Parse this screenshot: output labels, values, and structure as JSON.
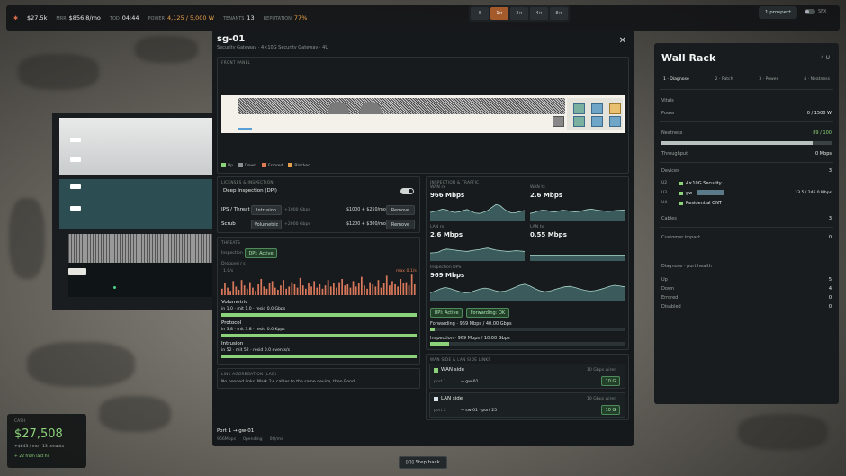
{
  "hud": {
    "status_icon": "bug-icon",
    "items": [
      {
        "label": "",
        "value": "$27.5k",
        "tone": "normal"
      },
      {
        "label": "MRR",
        "value": "$856.8/mo",
        "tone": "normal"
      },
      {
        "label": "TOD",
        "value": "04:44",
        "tone": "normal"
      },
      {
        "label": "POWER",
        "value": "4,125 / 5,000 W",
        "tone": "warn"
      },
      {
        "label": "TENANTS",
        "value": "13",
        "tone": "normal"
      },
      {
        "label": "REPUTATION",
        "value": "77%",
        "tone": "warn"
      }
    ],
    "speed_buttons": [
      "II",
      "1×",
      "2×",
      "4×",
      "8×"
    ],
    "speed_active": 1,
    "prospect_label": "1 prospect",
    "sfx_label": "SFX"
  },
  "modal": {
    "title": "sg-01",
    "subtitle": "Security Gateway · 4×10G Security Gateway · 4U",
    "close_icon": "close-icon",
    "front_panel": {
      "header": "FRONT PANEL",
      "legend": [
        {
          "label": "Up",
          "color": "#8cd27a"
        },
        {
          "label": "Down",
          "color": "#8a8f92"
        },
        {
          "label": "Errored",
          "color": "#e07a52"
        },
        {
          "label": "Blocked",
          "color": "#e0a050"
        }
      ]
    },
    "licenses": {
      "header": "LICENSES & INSPECTION",
      "dpi_label": "Deep Inspection (DPI)",
      "rows": [
        {
          "name": "IPS / Threat",
          "tier": "Intrusion",
          "cap": "+1000 Gbps",
          "price": "$1000 + $250/mo",
          "action": "Remove"
        },
        {
          "name": "Scrub",
          "tier": "Volumetric",
          "cap": "+2000 Gbps",
          "price": "$1200 + $300/mo",
          "action": "Remove"
        }
      ]
    },
    "threats": {
      "header": "THREATS",
      "inspection_label": "Inspection",
      "dpi_badge": "DPI: Active",
      "dropped_label": "Dropped / s",
      "scale_label": "1.0/s",
      "max_label": "max 0.1/s",
      "categories": [
        {
          "name": "Volumetric",
          "stats": "in 1.0 · mit 1.0 · resid 0.0 Gbps",
          "frac": 1.0
        },
        {
          "name": "Protocol",
          "stats": "in 3.8 · mit 3.8 · resid 0.0 Kpps",
          "frac": 1.0
        },
        {
          "name": "Intrusion",
          "stats": "in 52 · mit 52 · resid 0.0 events/s",
          "frac": 1.0
        }
      ],
      "drop_series": [
        0.3,
        0.55,
        0.35,
        0.2,
        0.65,
        0.4,
        0.25,
        0.7,
        0.45,
        0.3,
        0.6,
        0.35,
        0.2,
        0.5,
        0.75,
        0.4,
        0.3,
        0.55,
        0.65,
        0.35,
        0.25,
        0.45,
        0.7,
        0.3,
        0.4,
        0.6,
        0.5,
        0.35,
        0.8,
        0.45,
        0.3,
        0.55,
        0.4,
        0.65,
        0.35,
        0.5,
        0.3,
        0.45,
        0.7,
        0.4,
        0.55,
        0.35,
        0.6,
        0.75,
        0.45,
        0.5,
        0.35,
        0.65,
        0.4,
        0.55,
        0.85,
        0.45,
        0.3,
        0.6,
        0.5,
        0.4,
        0.7,
        0.35,
        0.55,
        0.9,
        0.45,
        0.65,
        0.5,
        0.4,
        0.75,
        0.55,
        0.6,
        0.45,
        0.95,
        0.5
      ]
    },
    "lag": {
      "header": "LINK AGGREGATION (LAG)",
      "text": "No bonded links. Mark 2+ cables to the same device, then Bond."
    },
    "inspection": {
      "header": "INSPECTION & TRAFFIC",
      "graphs": [
        {
          "label": "WAN rx",
          "value": "966 Mbps",
          "series": [
            0.45,
            0.5,
            0.55,
            0.62,
            0.58,
            0.5,
            0.45,
            0.48,
            0.55,
            0.6,
            0.5,
            0.42,
            0.4,
            0.46,
            0.55,
            0.7,
            0.85,
            0.8,
            0.62,
            0.48,
            0.42,
            0.45,
            0.5,
            0.55
          ]
        },
        {
          "label": "WAN tx",
          "value": "2.6 Mbps",
          "series": [
            0.4,
            0.45,
            0.52,
            0.56,
            0.55,
            0.5,
            0.48,
            0.52,
            0.56,
            0.54,
            0.5,
            0.48,
            0.5,
            0.55,
            0.6,
            0.62,
            0.58,
            0.55,
            0.52,
            0.5,
            0.52,
            0.55,
            0.56,
            0.58
          ]
        },
        {
          "label": "LAN rx",
          "value": "2.6 Mbps",
          "series": [
            0.4,
            0.42,
            0.45,
            0.55,
            0.6,
            0.58,
            0.55,
            0.52,
            0.5,
            0.48,
            0.52,
            0.55,
            0.58,
            0.62,
            0.65,
            0.6,
            0.55,
            0.52,
            0.5,
            0.48,
            0.5,
            0.52,
            0.5,
            0.48
          ]
        },
        {
          "label": "LAN tx",
          "value": "0.55 Mbps",
          "series": [
            0.3,
            0.3,
            0.3,
            0.3,
            0.3,
            0.3,
            0.3,
            0.3,
            0.3,
            0.3,
            0.3,
            0.3,
            0.3,
            0.3,
            0.3,
            0.3,
            0.3,
            0.3,
            0.3,
            0.3,
            0.3,
            0.3,
            0.3,
            0.3
          ]
        }
      ],
      "wide_graph": {
        "label": "Inspection DPS",
        "value": "969 Mbps",
        "series": [
          0.4,
          0.48,
          0.58,
          0.65,
          0.6,
          0.52,
          0.45,
          0.4,
          0.42,
          0.5,
          0.58,
          0.62,
          0.58,
          0.5,
          0.45,
          0.48,
          0.55,
          0.65,
          0.75,
          0.8,
          0.72,
          0.6,
          0.5,
          0.45,
          0.48,
          0.55,
          0.62,
          0.68,
          0.7,
          0.65,
          0.58,
          0.52,
          0.48,
          0.5,
          0.55,
          0.62,
          0.7,
          0.75,
          0.72,
          0.68
        ]
      },
      "dpi_badge": "DPI: Active",
      "fwd_badge": "Forwarding: OK",
      "forwarding_label": "Forwarding · 969 Mbps / 40.00 Gbps",
      "forwarding_frac": 0.025,
      "inspection_label": "Inspection · 969 Mbps / 10.00 Gbps",
      "inspection_frac": 0.097
    },
    "links": {
      "header": "WAN SIDE & LAN SIDE LINKS",
      "items": [
        {
          "side": "WAN side",
          "speed": "10 Gbps wired",
          "port": "port 1",
          "peer": "→ gw-01",
          "badge": "10 G",
          "color": "#8cd27a"
        },
        {
          "side": "LAN side",
          "speed": "10 Gbps wired",
          "port": "port 2",
          "peer": "→ sw-01 · port 25",
          "badge": "10 G",
          "color": "#d8e4ea"
        }
      ]
    },
    "footer": {
      "title": "Port 1 → gw-01",
      "items": [
        "966Mbps",
        "0pending",
        "0Q/ms"
      ]
    }
  },
  "rack": {
    "title": "Wall Rack",
    "size": "4 U",
    "tabs": [
      "1 · Diagnose",
      "2 · Patch",
      "3 · Power",
      "4 · Neatness"
    ],
    "active_tab": 0,
    "vitals_label": "Vitals",
    "power_label": "Power",
    "power_value": "0 / 1500 W",
    "neatness_label": "Neatness",
    "neatness_value": "89 / 100",
    "neatness_frac": 0.89,
    "throughput_label": "Throughput",
    "throughput_value": "0 Mbps",
    "devices_label": "Devices",
    "devices_count": "3",
    "devices": [
      {
        "slot": "U2",
        "name": "4×10G Security ·",
        "extra": "",
        "color": "#8cd27a"
      },
      {
        "slot": "U3",
        "name": "gw-",
        "extra": "13.5 / 246.0 Mbps",
        "color": "#8cd27a"
      },
      {
        "slot": "U4",
        "name": "Residential ONT",
        "extra": "",
        "color": "#8cd27a"
      }
    ],
    "cables_label": "Cables",
    "cables_value": "3",
    "impact_label": "Customer impact",
    "impact_value": "0",
    "impact_dash": "—",
    "diag_label": "Diagnose · port health",
    "health": [
      {
        "label": "Up",
        "value": "5"
      },
      {
        "label": "Down",
        "value": "4"
      },
      {
        "label": "Errored",
        "value": "0"
      },
      {
        "label": "Disabled",
        "value": "0"
      }
    ]
  },
  "cash": {
    "label": "CASH",
    "value": "$27,508",
    "sub1": "+$843 / mo · 13 tenants",
    "sub2": "+ 22 from last hr"
  },
  "step_back": "[Q]   Step back"
}
